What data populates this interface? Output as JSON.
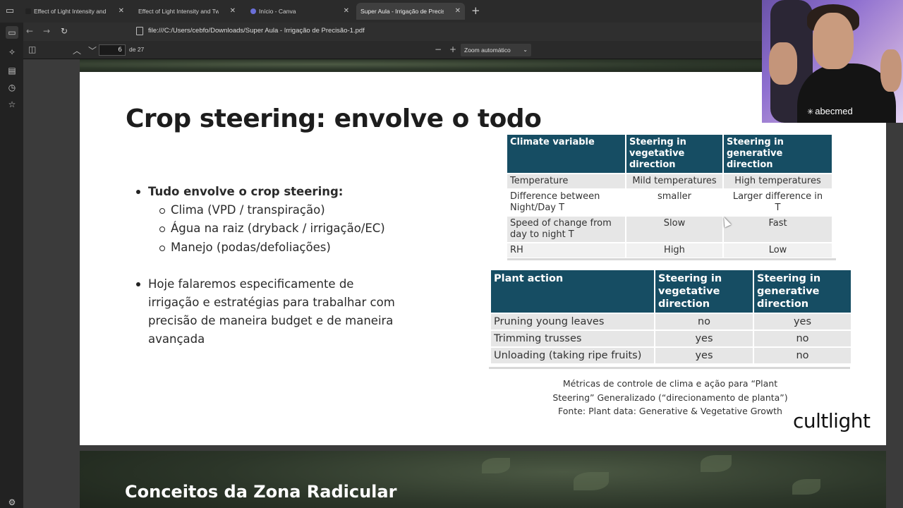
{
  "browser": {
    "tabs": [
      {
        "title": "Effect of Light Intensity and Two",
        "active": false,
        "favicon_color": "#222222"
      },
      {
        "title": "Effect of Light Intensity and Two Di",
        "active": false,
        "favicon_color": "#2b2b2b"
      },
      {
        "title": "Início - Canva",
        "active": false,
        "favicon_color": "#6a6fd8"
      },
      {
        "title": "Super Aula - Irrigação de PrecisãoS",
        "active": true,
        "favicon_color": "#3f3f3f"
      }
    ],
    "new_tab": "+",
    "close_glyph": "✕",
    "url": "file:///C:/Users/cebfo/Downloads/Super Aula - Irrigação de Precisão-1.pdf"
  },
  "pdf_toolbar": {
    "page_number": "6",
    "page_total": "de 27",
    "zoom_out": "−",
    "zoom_in": "+",
    "zoom_value": "Zoom automático"
  },
  "slide": {
    "title": "Crop steering: envolve o todo",
    "bullets": [
      {
        "text": "Tudo envolve o crop steering:",
        "sub": [
          "Clima (VPD / transpiração)",
          "Água na raiz (dryback / irrigação/EC)",
          "Manejo (podas/defoliações)"
        ]
      },
      {
        "lines": [
          "Hoje falaremos especificamente de",
          "irrigação e estratégias para trabalhar com",
          "precisão de maneira budget e de maneira",
          "avançada"
        ]
      }
    ],
    "climate_table": {
      "headers": [
        [
          "Climate variable"
        ],
        [
          "Steering in",
          "vegetative",
          "direction"
        ],
        [
          "Steering in",
          "generative",
          "direction"
        ]
      ],
      "rows": [
        [
          [
            "Temperature"
          ],
          [
            "Mild temperatures"
          ],
          [
            "High temperatures"
          ]
        ],
        [
          [
            "Difference between",
            "Night/Day T"
          ],
          [
            "smaller"
          ],
          [
            "Larger difference in",
            "T"
          ]
        ],
        [
          [
            "Speed of change from",
            "day to night T"
          ],
          [
            "Slow"
          ],
          [
            "Fast"
          ]
        ],
        [
          [
            "RH"
          ],
          [
            "High"
          ],
          [
            "Low"
          ]
        ]
      ]
    },
    "plant_table": {
      "headers": [
        [
          "Plant action"
        ],
        [
          "Steering in",
          "vegetative",
          "direction"
        ],
        [
          "Steering in",
          "generative",
          "direction"
        ]
      ],
      "rows": [
        [
          "Pruning young leaves",
          "no",
          "yes"
        ],
        [
          "Trimming trusses",
          "yes",
          "no"
        ],
        [
          "Unloading (taking ripe fruits)",
          "yes",
          "no"
        ]
      ]
    },
    "caption": [
      "Métricas de controle de clima  e ação para “Plant",
      "Steering” Generalizado (“direcionamento de planta”)",
      "Fonte: Plant data: Generative & Vegetative Growth"
    ],
    "logo": "cultlight"
  },
  "next_slide": {
    "title": "Conceitos da Zona Radicular"
  },
  "webcam": {
    "brand": "abecmed",
    "brand_mark": "✳"
  },
  "colors": {
    "table_header": "#164d63",
    "table_cell": "#e6e6e6"
  }
}
